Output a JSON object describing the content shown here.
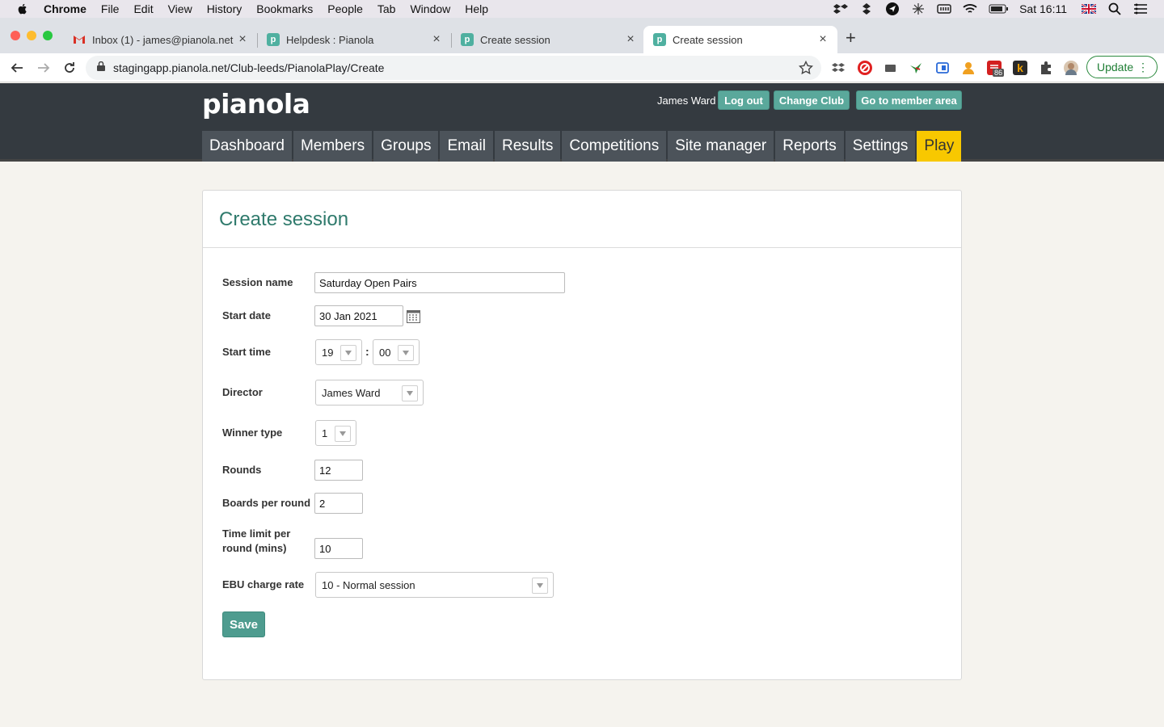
{
  "menubar": {
    "app": "Chrome",
    "items": [
      "File",
      "Edit",
      "View",
      "History",
      "Bookmarks",
      "People",
      "Tab",
      "Window",
      "Help"
    ],
    "clock": "Sat 16:11"
  },
  "tabs": [
    {
      "title": "Inbox (1) - james@pianola.net",
      "favicon": "gmail-icon"
    },
    {
      "title": "Helpdesk : Pianola",
      "favicon": "pianola-icon"
    },
    {
      "title": "Create session",
      "favicon": "pianola-icon"
    },
    {
      "title": "Create session",
      "favicon": "pianola-icon",
      "active": true
    }
  ],
  "address": {
    "url": "stagingapp.pianola.net/Club-leeds/PianolaPlay/Create",
    "update_label": "Update",
    "badge": "86"
  },
  "header": {
    "logo": "pianola",
    "user": "James Ward",
    "logout": "Log out",
    "change_club": "Change Club",
    "member_area": "Go to member area"
  },
  "nav": [
    "Dashboard",
    "Members",
    "Groups",
    "Email",
    "Results",
    "Competitions",
    "Site manager",
    "Reports",
    "Settings",
    "Play"
  ],
  "nav_active": "Play",
  "form": {
    "title": "Create session",
    "session_name_label": "Session name",
    "session_name": "Saturday Open Pairs",
    "start_date_label": "Start date",
    "start_date": "30 Jan 2021",
    "start_time_label": "Start time",
    "hour": "19",
    "minute": "00",
    "time_sep": ":",
    "director_label": "Director",
    "director": "James Ward",
    "winner_type_label": "Winner type",
    "winner_type": "1",
    "rounds_label": "Rounds",
    "rounds": "12",
    "boards_label": "Boards per round",
    "boards": "2",
    "time_limit_label_1": "Time limit per",
    "time_limit_label_2": "round (mins)",
    "time_limit": "10",
    "ebu_label": "EBU charge rate",
    "ebu": "10 - Normal session",
    "save": "Save"
  },
  "colors": {
    "header_bg": "#343a40",
    "accent": "#5aa89b",
    "title": "#2f7a6c",
    "nav_active": "#f8c800"
  }
}
